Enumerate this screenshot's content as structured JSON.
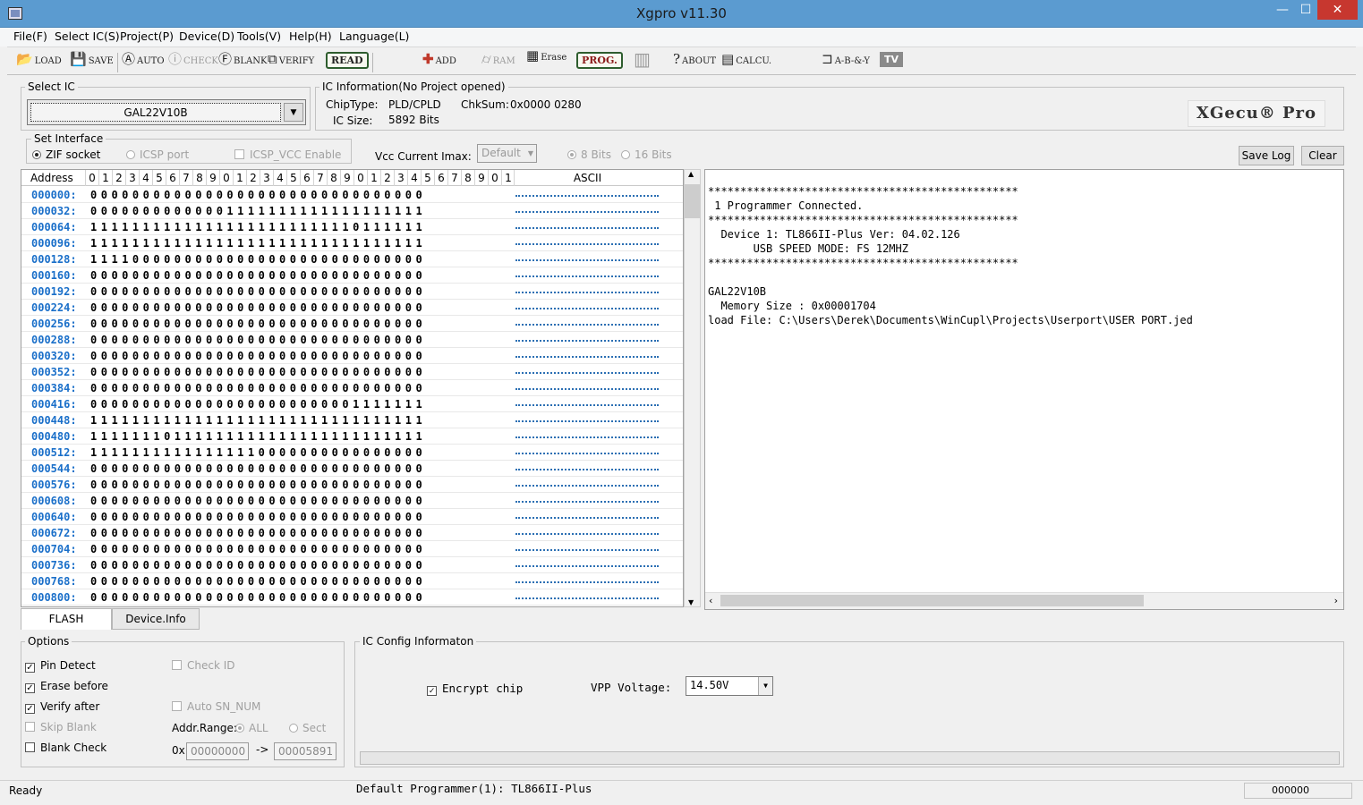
{
  "window": {
    "title": "Xgpro v11.30",
    "min": "—",
    "max": "☐",
    "close": "✕"
  },
  "menu": [
    "File(F)",
    "Select IC(S)",
    "Project(P)",
    "Device(D)",
    "Tools(V)",
    "Help(H)",
    "Language(L)"
  ],
  "toolbar": {
    "load": "LOAD",
    "save": "SAVE",
    "auto": "AUTO",
    "check": "CHECK",
    "blank": "BLANK",
    "verify": "VERIFY",
    "read": "READ",
    "add": "ADD",
    "ram": "RAM",
    "erase": "Erase",
    "prog": "PROG.",
    "about": "ABOUT",
    "calcu": "CALCU.",
    "logic": "A-B-&-Y",
    "tv": "TV"
  },
  "select_ic": {
    "legend": "Select IC",
    "value": "GAL22V10B"
  },
  "ic_info": {
    "legend": "IC Information(No Project opened)",
    "chip_type_label": "ChipType:",
    "chip_type": "PLD/CPLD",
    "chksum_label": "ChkSum:",
    "chksum": "0x0000 0280",
    "ic_size_label": "IC Size:",
    "ic_size": "5892 Bits",
    "logo": "XGecu® Pro"
  },
  "interface": {
    "legend": "Set Interface",
    "zif": "ZIF socket",
    "icsp": "ICSP port",
    "icsp_vcc": "ICSP_VCC Enable",
    "vcc_label": "Vcc Current Imax:",
    "vcc_value": "Default",
    "bits8": "8 Bits",
    "bits16": "16 Bits"
  },
  "log_buttons": {
    "save_log": "Save Log",
    "clear": "Clear"
  },
  "grid": {
    "address_header": "Address",
    "col_headers": [
      "0",
      "1",
      "2",
      "3",
      "4",
      "5",
      "6",
      "7",
      "8",
      "9",
      "0",
      "1",
      "2",
      "3",
      "4",
      "5",
      "6",
      "7",
      "8",
      "9",
      "0",
      "1",
      "2",
      "3",
      "4",
      "5",
      "6",
      "7",
      "8",
      "9",
      "0",
      "1"
    ],
    "ascii_header": "ASCII",
    "rows": [
      {
        "addr": "000000:",
        "bits": "00000000000000000000000000000000"
      },
      {
        "addr": "000032:",
        "bits": "00000000000001111111111111111111"
      },
      {
        "addr": "000064:",
        "bits": "11111111111111111111111110111111"
      },
      {
        "addr": "000096:",
        "bits": "11111111111111111111111111111111"
      },
      {
        "addr": "000128:",
        "bits": "11110000000000000000000000000000"
      },
      {
        "addr": "000160:",
        "bits": "00000000000000000000000000000000"
      },
      {
        "addr": "000192:",
        "bits": "00000000000000000000000000000000"
      },
      {
        "addr": "000224:",
        "bits": "00000000000000000000000000000000"
      },
      {
        "addr": "000256:",
        "bits": "00000000000000000000000000000000"
      },
      {
        "addr": "000288:",
        "bits": "00000000000000000000000000000000"
      },
      {
        "addr": "000320:",
        "bits": "00000000000000000000000000000000"
      },
      {
        "addr": "000352:",
        "bits": "00000000000000000000000000000000"
      },
      {
        "addr": "000384:",
        "bits": "00000000000000000000000000000000"
      },
      {
        "addr": "000416:",
        "bits": "00000000000000000000000001111111"
      },
      {
        "addr": "000448:",
        "bits": "11111111111111111111111111111111"
      },
      {
        "addr": "000480:",
        "bits": "11111110111111111111111111111111"
      },
      {
        "addr": "000512:",
        "bits": "11111111111111110000000000000000"
      },
      {
        "addr": "000544:",
        "bits": "00000000000000000000000000000000"
      },
      {
        "addr": "000576:",
        "bits": "00000000000000000000000000000000"
      },
      {
        "addr": "000608:",
        "bits": "00000000000000000000000000000000"
      },
      {
        "addr": "000640:",
        "bits": "00000000000000000000000000000000"
      },
      {
        "addr": "000672:",
        "bits": "00000000000000000000000000000000"
      },
      {
        "addr": "000704:",
        "bits": "00000000000000000000000000000000"
      },
      {
        "addr": "000736:",
        "bits": "00000000000000000000000000000000"
      },
      {
        "addr": "000768:",
        "bits": "00000000000000000000000000000000"
      },
      {
        "addr": "000800:",
        "bits": "00000000000000000000000000000000"
      }
    ]
  },
  "tabs": {
    "flash": "FLASH",
    "device_info": "Device.Info"
  },
  "log": {
    "lines": [
      "************************************************",
      " 1 Programmer Connected.",
      "************************************************",
      "  Device 1: TL866II-Plus Ver: 04.02.126",
      "       USB SPEED MODE: FS 12MHZ",
      "************************************************",
      "",
      "GAL22V10B",
      "  Memory Size : 0x00001704",
      "load File: C:\\Users\\Derek\\Documents\\WinCupl\\Projects\\Userport\\USER PORT.jed"
    ]
  },
  "options": {
    "legend": "Options",
    "pin_detect": "Pin Detect",
    "erase_before": "Erase before",
    "verify_after": "Verify after",
    "skip_blank": "Skip Blank",
    "blank_check": "Blank Check",
    "check_id": "Check ID",
    "auto_sn": "Auto SN_NUM",
    "addr_range": "Addr.Range:",
    "all": "ALL",
    "sect": "Sect",
    "hex_prefix": "0x",
    "arrow": "->",
    "addr_start": "00000000",
    "addr_end": "00005891",
    "check_mark": "✓"
  },
  "ic_config": {
    "legend": "IC Config Informaton",
    "encrypt": "Encrypt chip",
    "vpp_label": "VPP Voltage:",
    "vpp_value": "14.50V"
  },
  "status": {
    "ready": "Ready",
    "programmer": "Default Programmer(1): TL866II-Plus",
    "counter": "000000"
  }
}
